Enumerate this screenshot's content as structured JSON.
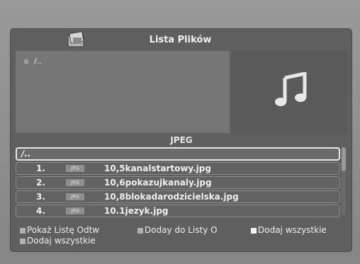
{
  "window": {
    "title": "Lista Plików"
  },
  "preview": {
    "path": "/.."
  },
  "list": {
    "type_label": "JPEG",
    "up_label": "/..",
    "badge": "JPG",
    "items": [
      {
        "index": "1.",
        "name": "10,5kanalstartowy.jpg"
      },
      {
        "index": "2.",
        "name": "10,6pokazujkanaly.jpg"
      },
      {
        "index": "3.",
        "name": "10,8blokadarodzicielska.jpg"
      },
      {
        "index": "4.",
        "name": "10.1jezyk.jpg"
      }
    ]
  },
  "footer": {
    "items": [
      {
        "label": "Pokaż Listę Odtw",
        "color": "#b0b0b0"
      },
      {
        "label": "Doday do Listy O",
        "color": "#b0b0b0"
      },
      {
        "label": "Dodaj wszystkie",
        "color": "#f4f4f4"
      },
      {
        "label": "Dodaj wszystkie",
        "color": "#b0b0b0"
      }
    ]
  },
  "icons": {
    "header": "folder-icon",
    "preview": "music-note-icon"
  },
  "colors": {
    "background": "#8c8c8c",
    "panel": "#5f5f5f",
    "text": "#f0f0f0"
  }
}
